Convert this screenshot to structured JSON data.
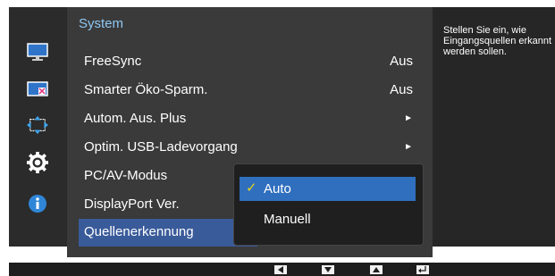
{
  "menu": {
    "title": "System",
    "items": [
      {
        "label": "FreeSync",
        "value": "Aus"
      },
      {
        "label": "Smarter Öko-Sparm.",
        "value": "Aus"
      },
      {
        "label": "Autom. Aus. Plus",
        "value": "►"
      },
      {
        "label": "Optim. USB-Ladevorgang",
        "value": "►"
      },
      {
        "label": "PC/AV-Modus",
        "value": ""
      },
      {
        "label": "DisplayPort Ver.",
        "value": ""
      },
      {
        "label": "Quellenerkennung",
        "value": ""
      }
    ]
  },
  "dropdown": {
    "options": [
      {
        "label": "Auto",
        "selected": true,
        "check": "✓"
      },
      {
        "label": "Manuell",
        "selected": false
      }
    ]
  },
  "help": {
    "text": "Stellen Sie ein, wie Eingangsquellen erkannt werden sollen."
  },
  "sidebar_icons": [
    "monitor-icon",
    "color-icon",
    "screen-size-icon",
    "settings-gear-icon",
    "info-icon"
  ],
  "colors": {
    "accent": "#2f6fbe",
    "highlight": "#3a5b9a",
    "check": "#e7d21a",
    "title": "#8ec8f5"
  }
}
